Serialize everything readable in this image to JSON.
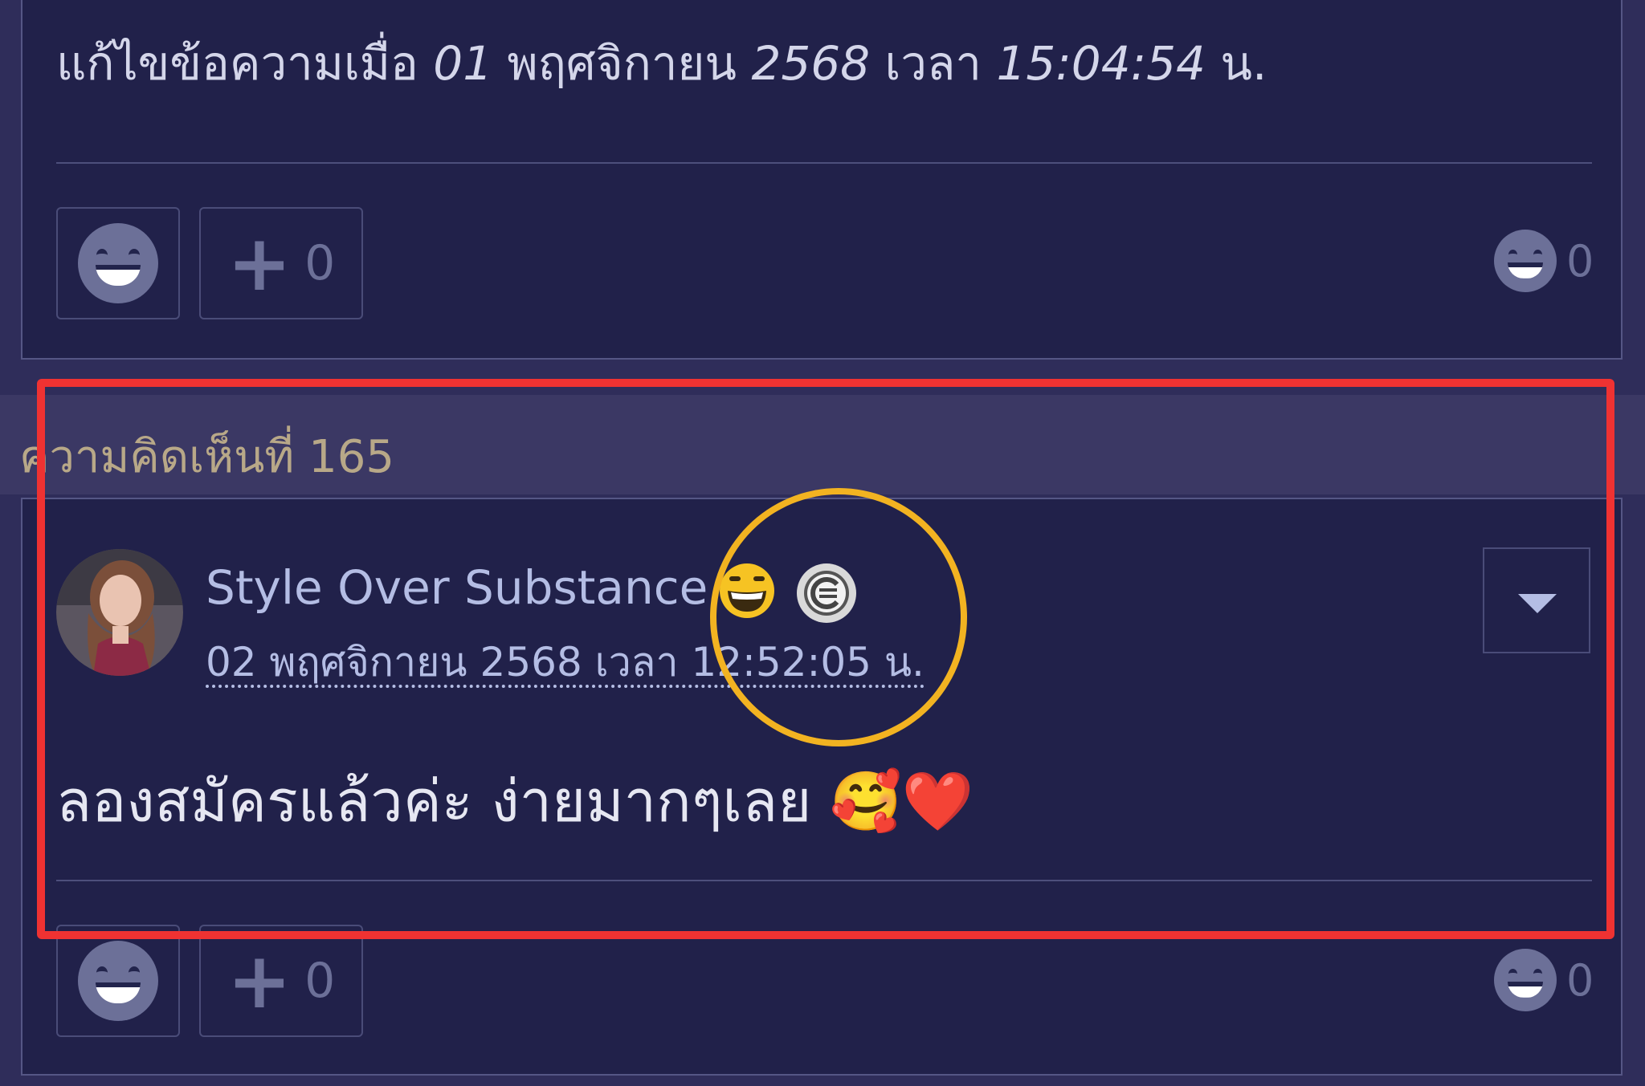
{
  "previous_comment": {
    "edited_prefix": "แก้ไขข้อความเมื่อ",
    "edited_day": "01",
    "edited_month_year": "พฤศจิกายน",
    "edited_year": "2568",
    "edited_time_word": "เวลา",
    "edited_time": "15:04:54",
    "edited_suffix": "น.",
    "plus_count": "0",
    "reaction_count": "0"
  },
  "comment": {
    "header_label": "ความคิดเห็นที่ 165",
    "username": "Style Over Substance",
    "date": "02 พฤศจิกายน 2568 เวลา 12:52:05 น.",
    "body": "ลองสมัครแล้วค่ะ ง่ายมากๆเลย",
    "emojis": "🥰❤️",
    "plus_count": "0",
    "reaction_count": "0"
  },
  "icons": {
    "smiley_reaction": "smiley-icon",
    "plus": "plus-icon",
    "menu": "chevron-down-icon",
    "badge_emoji": "grinning-face-icon",
    "badge_c": "c-badge-icon"
  },
  "colors": {
    "background": "#2f2d5a",
    "card": "#21214a",
    "highlight_box": "#ef3232",
    "highlight_circle": "#f2b321",
    "username": "#b4bde4"
  }
}
